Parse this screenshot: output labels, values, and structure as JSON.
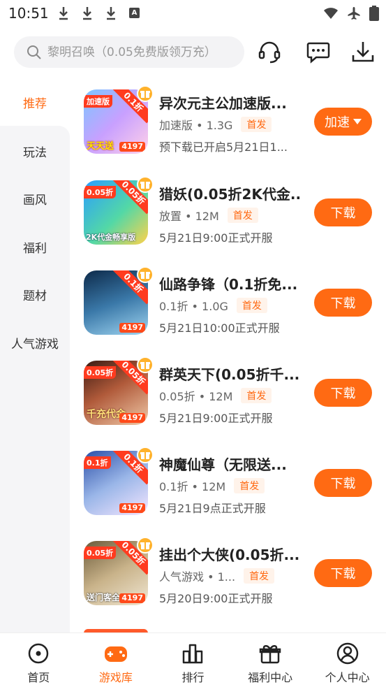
{
  "status": {
    "time": "10:51",
    "a_label": "A"
  },
  "search": {
    "placeholder": "黎明召唤（0.05免费版领万充）"
  },
  "header_icons": [
    "headset-icon",
    "chat-icon",
    "download-icon"
  ],
  "categories": [
    "推荐",
    "玩法",
    "画风",
    "福利",
    "题材",
    "人气游戏"
  ],
  "games": [
    {
      "title": "异次元主公加速版...",
      "meta": "加速版 • 1.3G",
      "tag": "首发",
      "sub": "预下载已开启5月21日1...",
      "button": "加速",
      "icon_top": "加速版",
      "ribbon": "0.1折",
      "bottom_text": "天天送",
      "badge": "4197"
    },
    {
      "title": "猎妖(0.05折2K代金...",
      "meta": "放置 • 12M",
      "tag": "首发",
      "sub": "5月21日9:00正式开服",
      "button": "下载",
      "icon_top": "0.05折",
      "ribbon": "0.05折",
      "bottom_text": "2K代金畅享版",
      "badge": ""
    },
    {
      "title": "仙路争锋（0.1折免...",
      "meta": "0.1折 • 1.0G",
      "tag": "首发",
      "sub": "5月21日10:00正式开服",
      "button": "下载",
      "icon_top": "",
      "ribbon": "0.1折",
      "bottom_text": "",
      "badge": "4197"
    },
    {
      "title": "群英天下(0.05折千...",
      "meta": "0.05折 • 12M",
      "tag": "首发",
      "sub": "5月21日9:00正式开服",
      "button": "下载",
      "icon_top": "0.05折",
      "ribbon": "0.05折",
      "bottom_text": "千充代金",
      "badge": "4197"
    },
    {
      "title": "神魔仙尊（无限送...",
      "meta": "0.1折 • 12M",
      "tag": "首发",
      "sub": "5月21日9点正式开服",
      "button": "下载",
      "icon_top": "0.1折",
      "ribbon": "0.1折",
      "bottom_text": "",
      "badge": "4197"
    },
    {
      "title": "挂出个大侠(0.05折...",
      "meta": "人气游戏 • 1...",
      "tag": "首发",
      "sub": "5月20日9:00正式开服",
      "button": "下载",
      "icon_top": "0.05折",
      "ribbon": "0.05折",
      "bottom_text": "送门客全",
      "badge": "4197"
    }
  ],
  "nav": [
    {
      "label": "首页",
      "icon": "home-icon"
    },
    {
      "label": "游戏库",
      "icon": "gamepad-icon"
    },
    {
      "label": "排行",
      "icon": "ranking-icon"
    },
    {
      "label": "福利中心",
      "icon": "gift-icon"
    },
    {
      "label": "个人中心",
      "icon": "profile-icon"
    }
  ],
  "colors": {
    "accent": "#ff6a13",
    "sidebar_bg": "#f5f5f7",
    "search_bg": "#f3f3f5"
  }
}
